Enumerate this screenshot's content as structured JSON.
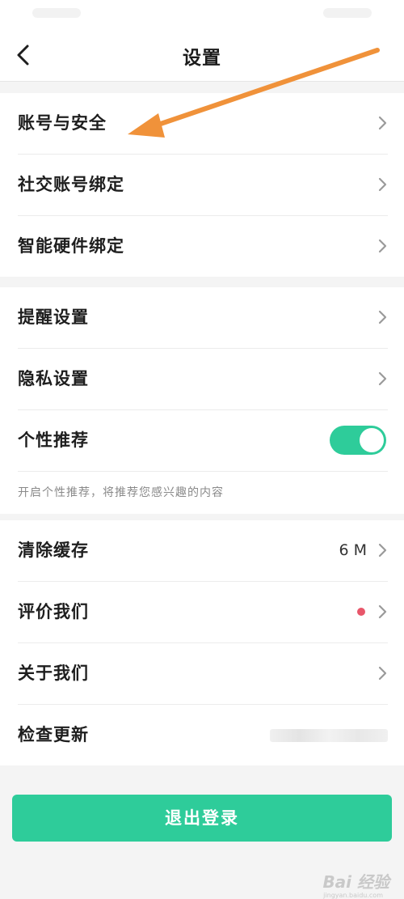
{
  "header": {
    "title": "设置"
  },
  "group1": [
    {
      "label": "账号与安全"
    },
    {
      "label": "社交账号绑定"
    },
    {
      "label": "智能硬件绑定"
    }
  ],
  "group2": {
    "items": [
      {
        "label": "提醒设置"
      },
      {
        "label": "隐私设置"
      }
    ],
    "personal": {
      "label": "个性推荐",
      "enabled": true
    },
    "hint": "开启个性推荐，将推荐您感兴趣的内容"
  },
  "group3": [
    {
      "label": "清除缓存",
      "value": "6 M"
    },
    {
      "label": "评价我们"
    },
    {
      "label": "关于我们"
    },
    {
      "label": "检查更新"
    }
  ],
  "logout_label": "退出登录",
  "watermark": "Bai 经验",
  "watermark_sub": "jingyan.baidu.com",
  "colors": {
    "accent": "#2ecc9a",
    "dot": "#e8566a",
    "annotation_arrow": "#f0923a"
  }
}
